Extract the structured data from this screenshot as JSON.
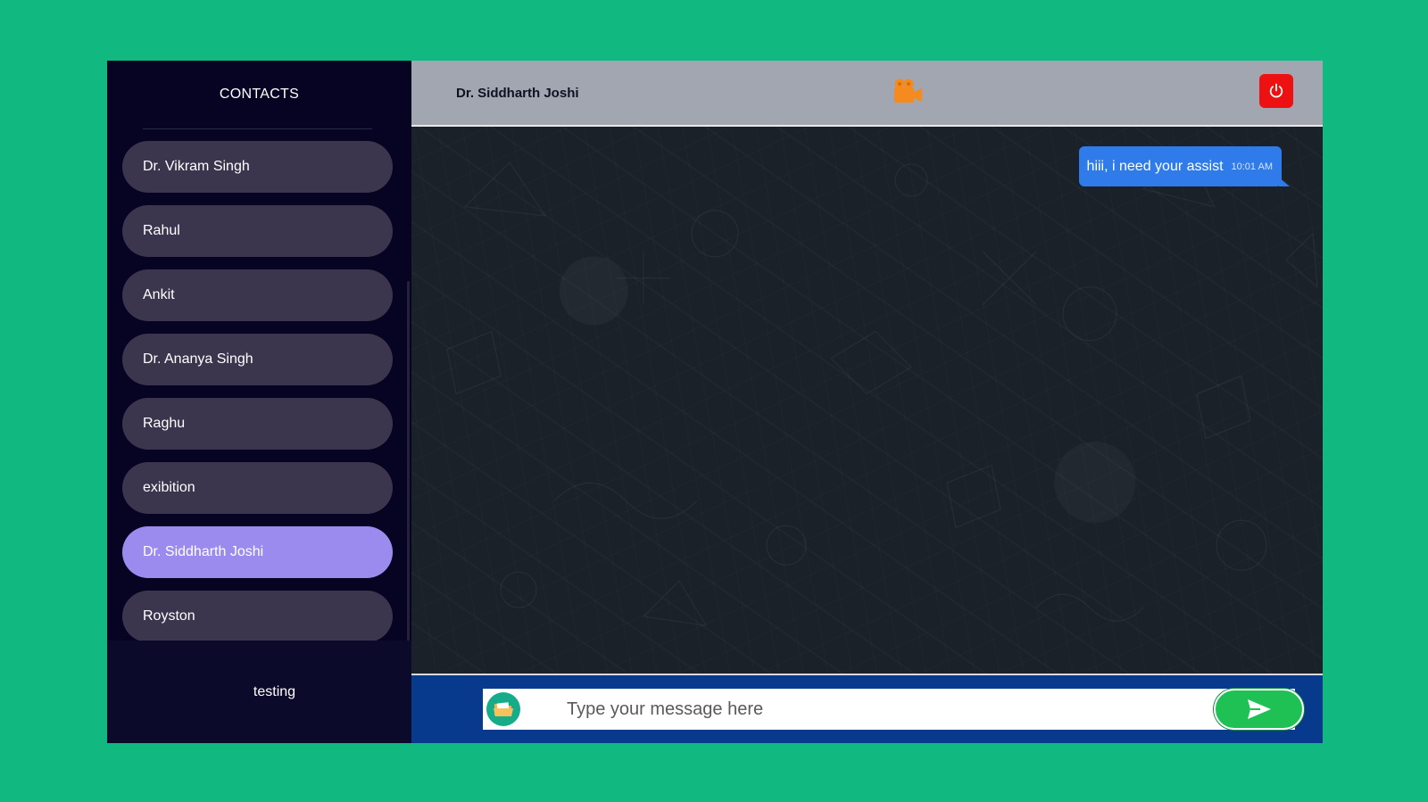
{
  "sidebar": {
    "header": "CONTACTS",
    "contacts": [
      {
        "label": "Dr. Vikram Singh"
      },
      {
        "label": "Rahul"
      },
      {
        "label": "Ankit"
      },
      {
        "label": "Dr. Ananya Singh"
      },
      {
        "label": "Raghu"
      },
      {
        "label": "exibition"
      },
      {
        "label": "Dr. Siddharth Joshi"
      },
      {
        "label": "Royston"
      }
    ],
    "active_contact": "Dr. Siddharth Joshi",
    "footer": "testing"
  },
  "chat": {
    "title": "Dr. Siddharth Joshi",
    "video_icon": "video-camera-icon",
    "power_icon": "power-icon",
    "messages": [
      {
        "text": "hiii, i need your assist",
        "time": "10:01 AM",
        "direction": "outgoing"
      }
    ],
    "composer": {
      "placeholder": "Type your message here",
      "attach_icon": "folder-icon",
      "send_icon": "send-icon"
    }
  },
  "colors": {
    "page_background": "#11b981",
    "sidebar_background": "#060323",
    "contact_item": "#3b364d",
    "contact_item_active": "#9b8bef",
    "header_background": "#a2a6b1",
    "bubble_outgoing": "#2f7bea",
    "composer_background": "#073a8c",
    "power_button": "#ee1111",
    "send_button": "#1fc155",
    "video_icon": "#f58a1f"
  }
}
